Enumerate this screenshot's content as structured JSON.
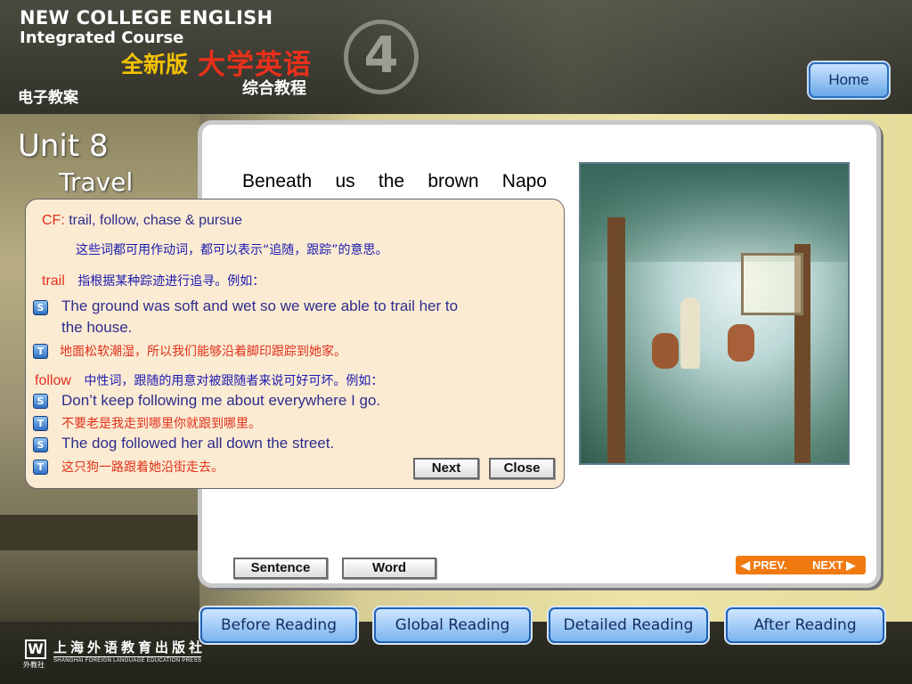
{
  "header": {
    "title_line1": "NEW COLLEGE ENGLISH",
    "title_line2": "Integrated Course",
    "brand_cn_yellow": "全新版",
    "brand_cn_red": "大学英语",
    "brand_cn_sub": "综合教程",
    "book_number": "4",
    "subtitle_cn": "电子教案",
    "home_label": "Home"
  },
  "unit": {
    "number": "Unit 8",
    "title": "Travel"
  },
  "passage": {
    "visible_text": "Beneath us the brown Napo"
  },
  "popup": {
    "cf_label": "CF:",
    "cf_words": "trail, follow, chase & pursue",
    "cf_note": "这些词都可用作动词，都可以表示“追随，跟踪”的意思。",
    "trail": {
      "word": "trail",
      "note": "指根据某种踪迹进行追寻。例如：",
      "examples": [
        {
          "en_line1": "The ground was soft and wet so we were able to trail her to",
          "en_line2": "the house.",
          "cn": "地面松软潮湿，所以我们能够沿着脚印跟踪到她家。"
        }
      ]
    },
    "follow": {
      "word": "follow",
      "note": "中性词，跟随的用意对被跟随者来说可好可坏。例如：",
      "examples": [
        {
          "en": "Don’t keep following me about everywhere I go.",
          "cn": "不要老是我走到哪里你就跟到哪里。"
        },
        {
          "en": "The dog followed her all down the street.",
          "cn": "这只狗一路跟着她沿街走去。"
        }
      ]
    },
    "next_label": "Next",
    "close_label": "Close"
  },
  "panel_buttons": {
    "sentence_label": "Sentence",
    "word_label": "Word",
    "prev_label": "PREV.",
    "next_label": "NEXT"
  },
  "nav": {
    "tabs": [
      "Before Reading",
      "Global Reading",
      "Detailed Reading",
      "After Reading"
    ]
  },
  "publisher": {
    "mark": "W",
    "short": "外教社",
    "name": "上海外语教育出版社",
    "english": "SHANGHAI FOREIGN LANGUAGE EDUCATION PRESS"
  },
  "icons": {
    "sentence_icon": "S",
    "translation_icon": "T"
  },
  "colors": {
    "accent_red": "#e0301a",
    "english_blue": "#2d2d8c",
    "nav_blue": "#1f60b5",
    "prevnext_orange": "#f07a10"
  }
}
